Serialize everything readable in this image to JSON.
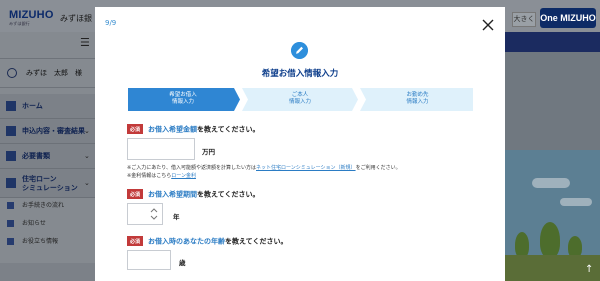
{
  "background": {
    "logo": "MIZUHO",
    "logo_sub": "みずほ銀行",
    "bank_name": "みずほ銀",
    "zoom_button": "大きく",
    "onemizuho_logo": "One MIZUHO",
    "user_name": "みずほ　太郎　様",
    "nav": [
      {
        "label": "ホーム",
        "icon": "home-icon"
      },
      {
        "label": "申込内容・審査結果",
        "icon": "document-icon"
      },
      {
        "label": "必要書類",
        "icon": "folder-icon"
      },
      {
        "label": "住宅ローン\nシミュレーション",
        "icon": "chart-icon"
      }
    ],
    "small_nav": [
      {
        "label": "お手続きの流れ",
        "icon": "flow-icon"
      },
      {
        "label": "お知らせ",
        "icon": "bell-icon"
      },
      {
        "label": "お役立ち情報",
        "icon": "book-icon"
      }
    ]
  },
  "modal": {
    "step_count": "9/9",
    "close_label": "close",
    "title": "希望お借入情報入力",
    "steps": [
      {
        "line1": "希望お借入",
        "line2": "情報入力",
        "active": true
      },
      {
        "line1": "ご本人",
        "line2": "情報入力",
        "active": false
      },
      {
        "line1": "お勤め先",
        "line2": "情報入力",
        "active": false
      }
    ],
    "questions": [
      {
        "required": "必須",
        "emph": "お借入希望金額",
        "rest": "を教えてください。",
        "unit": "万円"
      },
      {
        "required": "必須",
        "emph": "お借入希望期間",
        "rest": "を教えてください。",
        "unit": "年"
      },
      {
        "required": "必須",
        "emph": "お借入時のあなたの年齢",
        "rest": "を教えてください。",
        "unit": "歳"
      }
    ],
    "note1_pre": "※ご入力にあたり、借入可能額や返済額を計算したい方は",
    "note1_link": "ネット住宅ローンシミュレーション（新規）",
    "note1_post": "をご利用ください。",
    "note2_pre": "※金利情報はこちら",
    "note2_link": "ローン金利"
  },
  "colors": {
    "accent": "#2e8fdc",
    "title": "#0f3f8c",
    "step_active": "#2f86d3",
    "step_inactive": "#dff1fb",
    "required": "#c23a3a"
  }
}
